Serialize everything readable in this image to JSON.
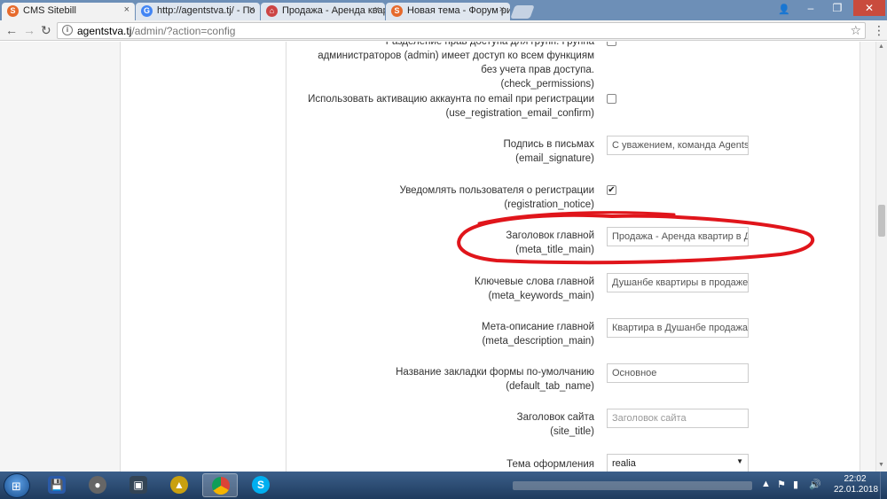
{
  "browser": {
    "tabs": [
      {
        "label": "CMS Sitebill",
        "icon": "S",
        "color": "#e66a2c",
        "active": true
      },
      {
        "label": "http://agentstva.tj/ - По",
        "icon": "G",
        "color": "#4285f4",
        "active": false
      },
      {
        "label": "Продажа - Аренда кварт",
        "icon": "⌂",
        "color": "#c44",
        "active": false
      },
      {
        "label": "Новая тема - Форум ри",
        "icon": "S",
        "color": "#e66a2c",
        "active": false
      }
    ],
    "close_glyph": "×",
    "address_url": "agentstva.tj",
    "address_path": "/admin/?action=config",
    "window_controls": [
      "–",
      "❐",
      "✕"
    ]
  },
  "settings": {
    "check_permissions": {
      "label": "Разделение прав доступа для групп. Группа администраторов (admin) имеет доступ ко всем функциям без учета прав доступа.",
      "key": "(check_permissions)"
    },
    "use_registration_email_confirm": {
      "label": "Использовать активацию аккаунта по email при регистрации",
      "key": "(use_registration_email_confirm)",
      "checked": false
    },
    "email_signature": {
      "label": "Подпись в письмах",
      "key": "(email_signature)",
      "value": "С уважением, команда Agentstv"
    },
    "registration_notice": {
      "label": "Уведомлять пользователя о регистрации",
      "key": "(registration_notice)",
      "checked": true
    },
    "meta_title_main": {
      "label": "Заголовок главной",
      "key": "(meta_title_main)",
      "value": "Продажа - Аренда квартир в Ду"
    },
    "meta_keywords_main": {
      "label": "Ключевые слова главной",
      "key": "(meta_keywords_main)",
      "value": "Душанбе квартиры в продаже и"
    },
    "meta_description_main": {
      "label": "Мета-описание главной",
      "key": "(meta_description_main)",
      "value": "Квартира в Душанбе продажа -"
    },
    "default_tab_name": {
      "label": "Название закладки формы по-умолчанию",
      "key": "(default_tab_name)",
      "value": "Основное"
    },
    "site_title": {
      "label": "Заголовок сайта",
      "key": "(site_title)",
      "placeholder": "Заголовок сайта"
    },
    "theme": {
      "label": "Тема оформления",
      "value": "realia"
    }
  },
  "taskbar": {
    "apps": [
      "save-disk",
      "film-reel",
      "media-player",
      "archive",
      "chrome",
      "skype"
    ],
    "time": "22:02",
    "date": "22.01.2018"
  },
  "colors": {
    "annotation": "#e0151b",
    "taskbar": "#284b76"
  }
}
